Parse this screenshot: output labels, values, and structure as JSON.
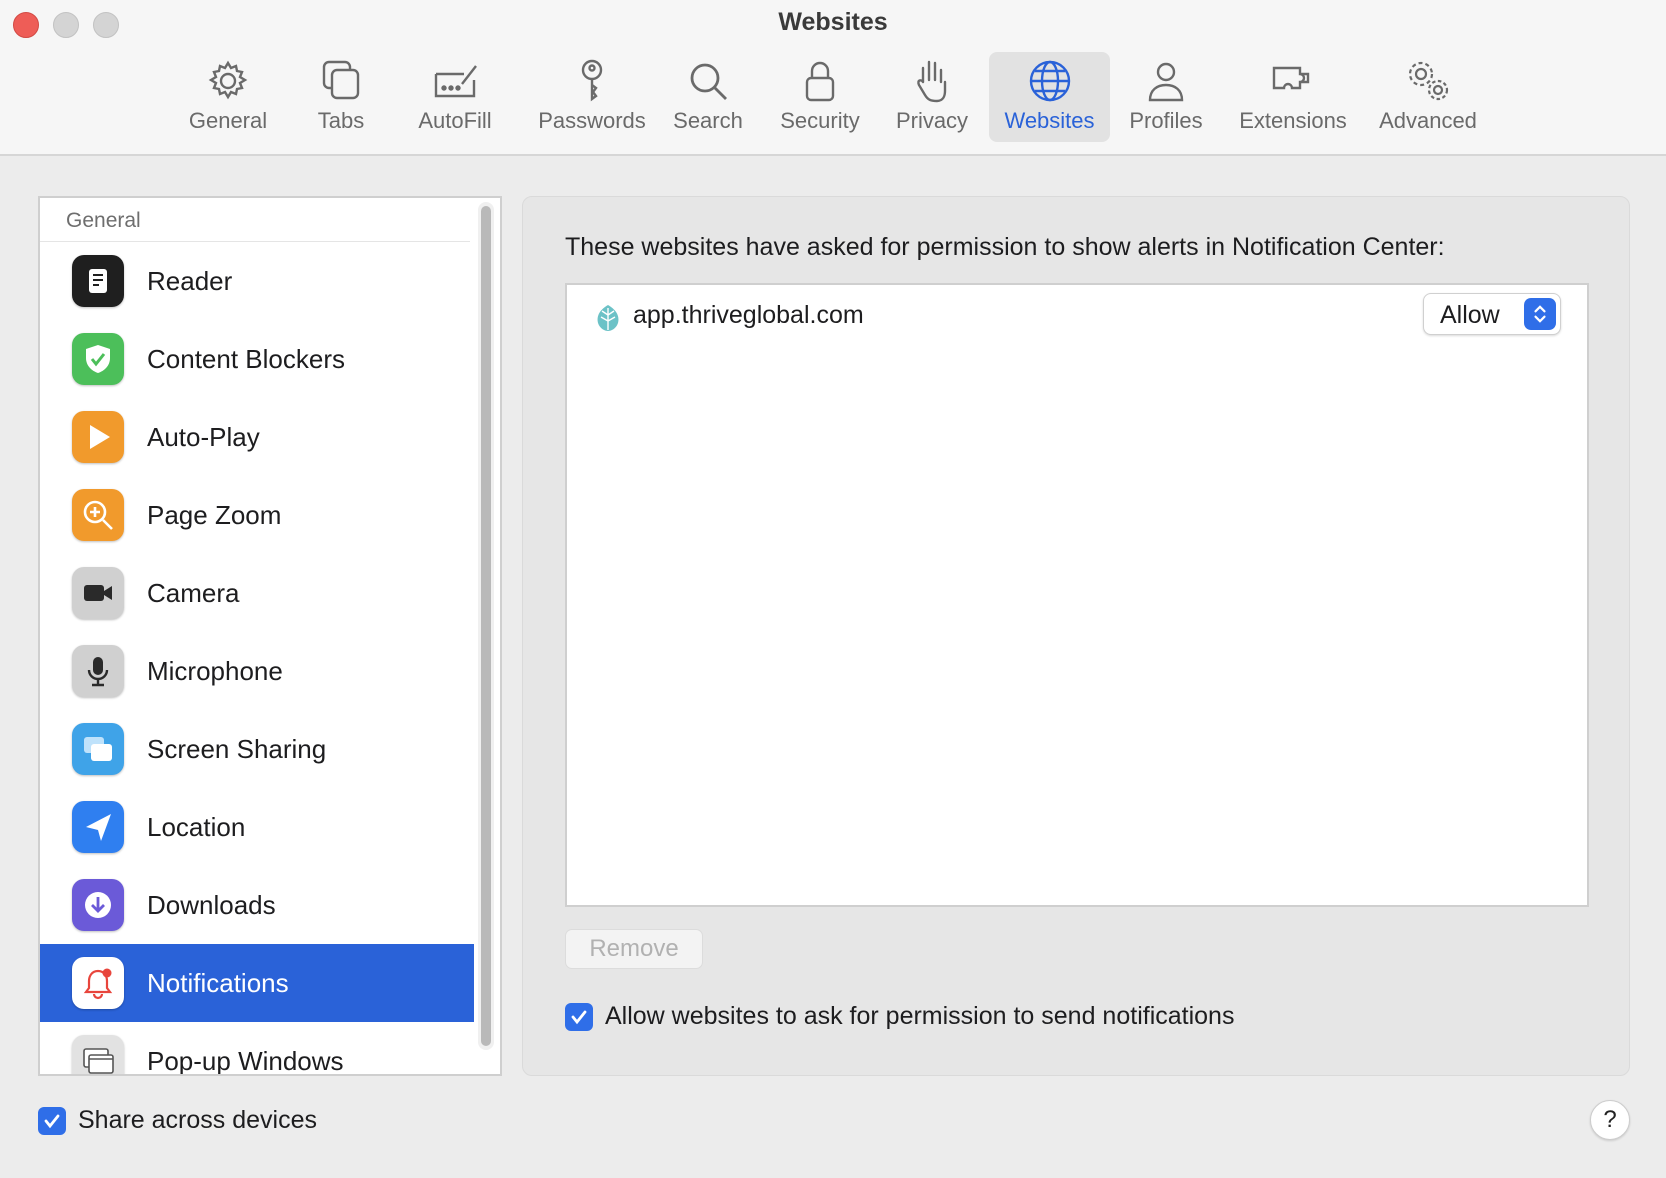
{
  "window": {
    "title": "Websites"
  },
  "toolbar": {
    "tabs": [
      {
        "label": "General",
        "icon": "gear-icon"
      },
      {
        "label": "Tabs",
        "icon": "tabs-icon"
      },
      {
        "label": "AutoFill",
        "icon": "autofill-icon"
      },
      {
        "label": "Passwords",
        "icon": "key-icon"
      },
      {
        "label": "Search",
        "icon": "search-icon"
      },
      {
        "label": "Security",
        "icon": "lock-icon"
      },
      {
        "label": "Privacy",
        "icon": "hand-icon"
      },
      {
        "label": "Websites",
        "icon": "globe-icon",
        "active": true
      },
      {
        "label": "Profiles",
        "icon": "person-icon"
      },
      {
        "label": "Extensions",
        "icon": "puzzle-icon"
      },
      {
        "label": "Advanced",
        "icon": "gears-icon"
      }
    ]
  },
  "sidebar": {
    "header": "General",
    "items": [
      {
        "label": "Reader",
        "icon": "reader-icon"
      },
      {
        "label": "Content Blockers",
        "icon": "shield-check-icon"
      },
      {
        "label": "Auto-Play",
        "icon": "play-icon"
      },
      {
        "label": "Page Zoom",
        "icon": "zoom-icon"
      },
      {
        "label": "Camera",
        "icon": "camera-icon"
      },
      {
        "label": "Microphone",
        "icon": "microphone-icon"
      },
      {
        "label": "Screen Sharing",
        "icon": "screen-sharing-icon"
      },
      {
        "label": "Location",
        "icon": "location-arrow-icon"
      },
      {
        "label": "Downloads",
        "icon": "download-icon"
      },
      {
        "label": "Notifications",
        "icon": "bell-icon",
        "selected": true
      },
      {
        "label": "Pop-up Windows",
        "icon": "popup-windows-icon"
      }
    ]
  },
  "main": {
    "description": "These websites have asked for permission to show alerts in Notification Center:",
    "sites": [
      {
        "domain": "app.thriveglobal.com",
        "permission": "Allow"
      }
    ],
    "remove_label": "Remove",
    "ask_permission_label": "Allow websites to ask for permission to send notifications",
    "ask_permission_checked": true
  },
  "footer": {
    "share_label": "Share across devices",
    "share_checked": true,
    "help_label": "?"
  },
  "colors": {
    "accent": "#2a62d8",
    "selection": "#2a62d8",
    "close_button": "#ee5d57"
  }
}
